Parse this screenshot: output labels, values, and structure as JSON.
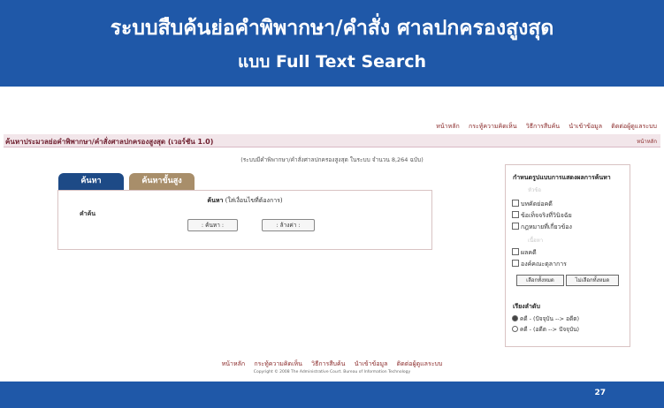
{
  "header": {
    "title": "ระบบสืบค้นย่อคำพิพากษา/คำสั่ง ศาลปกครองสูงสุด",
    "subtitle": "แบบ Full Text Search"
  },
  "topnav": [
    "หน้าหลัก",
    "กระทู้ความคิดเห็น",
    "วิธีการสืบค้น",
    "นำเข้าข้อมูล",
    "ติดต่อผู้ดูแลระบบ"
  ],
  "titlebar": {
    "title": "ค้นหาประมวลย่อคำพิพากษา/คำสั่งศาลปกครองสูงสุด (เวอร์ชัน 1.0)",
    "home": "หน้าหลัก"
  },
  "count_text": "(ระบบมีคำพิพากษา/คำสั่งศาลปกครองสูงสุด ในระบบ จำนวน 8,264 ฉบับ)",
  "tabs": [
    "ค้นหา",
    "ค้นหาขั้นสูง"
  ],
  "search": {
    "keyword_title": "ค้นหา",
    "keyword_hint": "(ใส่เงื่อนไขที่ต้องการ)",
    "field_label": "คำค้น",
    "search_button": ": ค้นหา :",
    "clear_button": ": ล้างค่า :"
  },
  "options": {
    "heading": "กำหนดรูปแบบการแสดงผลการค้นหา",
    "faint_top": "หัวข้อ",
    "faint_mid": "เนื้อหา",
    "checkboxes": [
      "บทคัดย่อคดี",
      "ข้อเท็จจริงที่วินิจฉัย",
      "กฎหมายที่เกี่ยวข้อง",
      "ผลคดี",
      "องค์คณะตุลาการ"
    ],
    "select_all": "เลือกทั้งหมด",
    "deselect_all": "ไม่เลือกทั้งหมด",
    "sort_heading": "เรียงลำดับ",
    "sort_options": [
      "คดี - (ปัจจุบัน --> อดีต)",
      "คดี - (อดีต --> ปัจจุบัน)"
    ],
    "sort_selected": 0
  },
  "footer": {
    "nav": [
      "หน้าหลัก",
      "กระทู้ความคิดเห็น",
      "วิธีการสืบค้น",
      "นำเข้าข้อมูล",
      "ติดต่อผู้ดูแลระบบ"
    ],
    "copyright": "Copyright © 2008 The Administrative Court. Bureau of Information Technology"
  },
  "page_number": "27",
  "colors": {
    "banner": "#1f58a8",
    "tab_active": "#1d4a86",
    "tab_inactive": "#a88e6a",
    "link": "#8a2a2a"
  }
}
